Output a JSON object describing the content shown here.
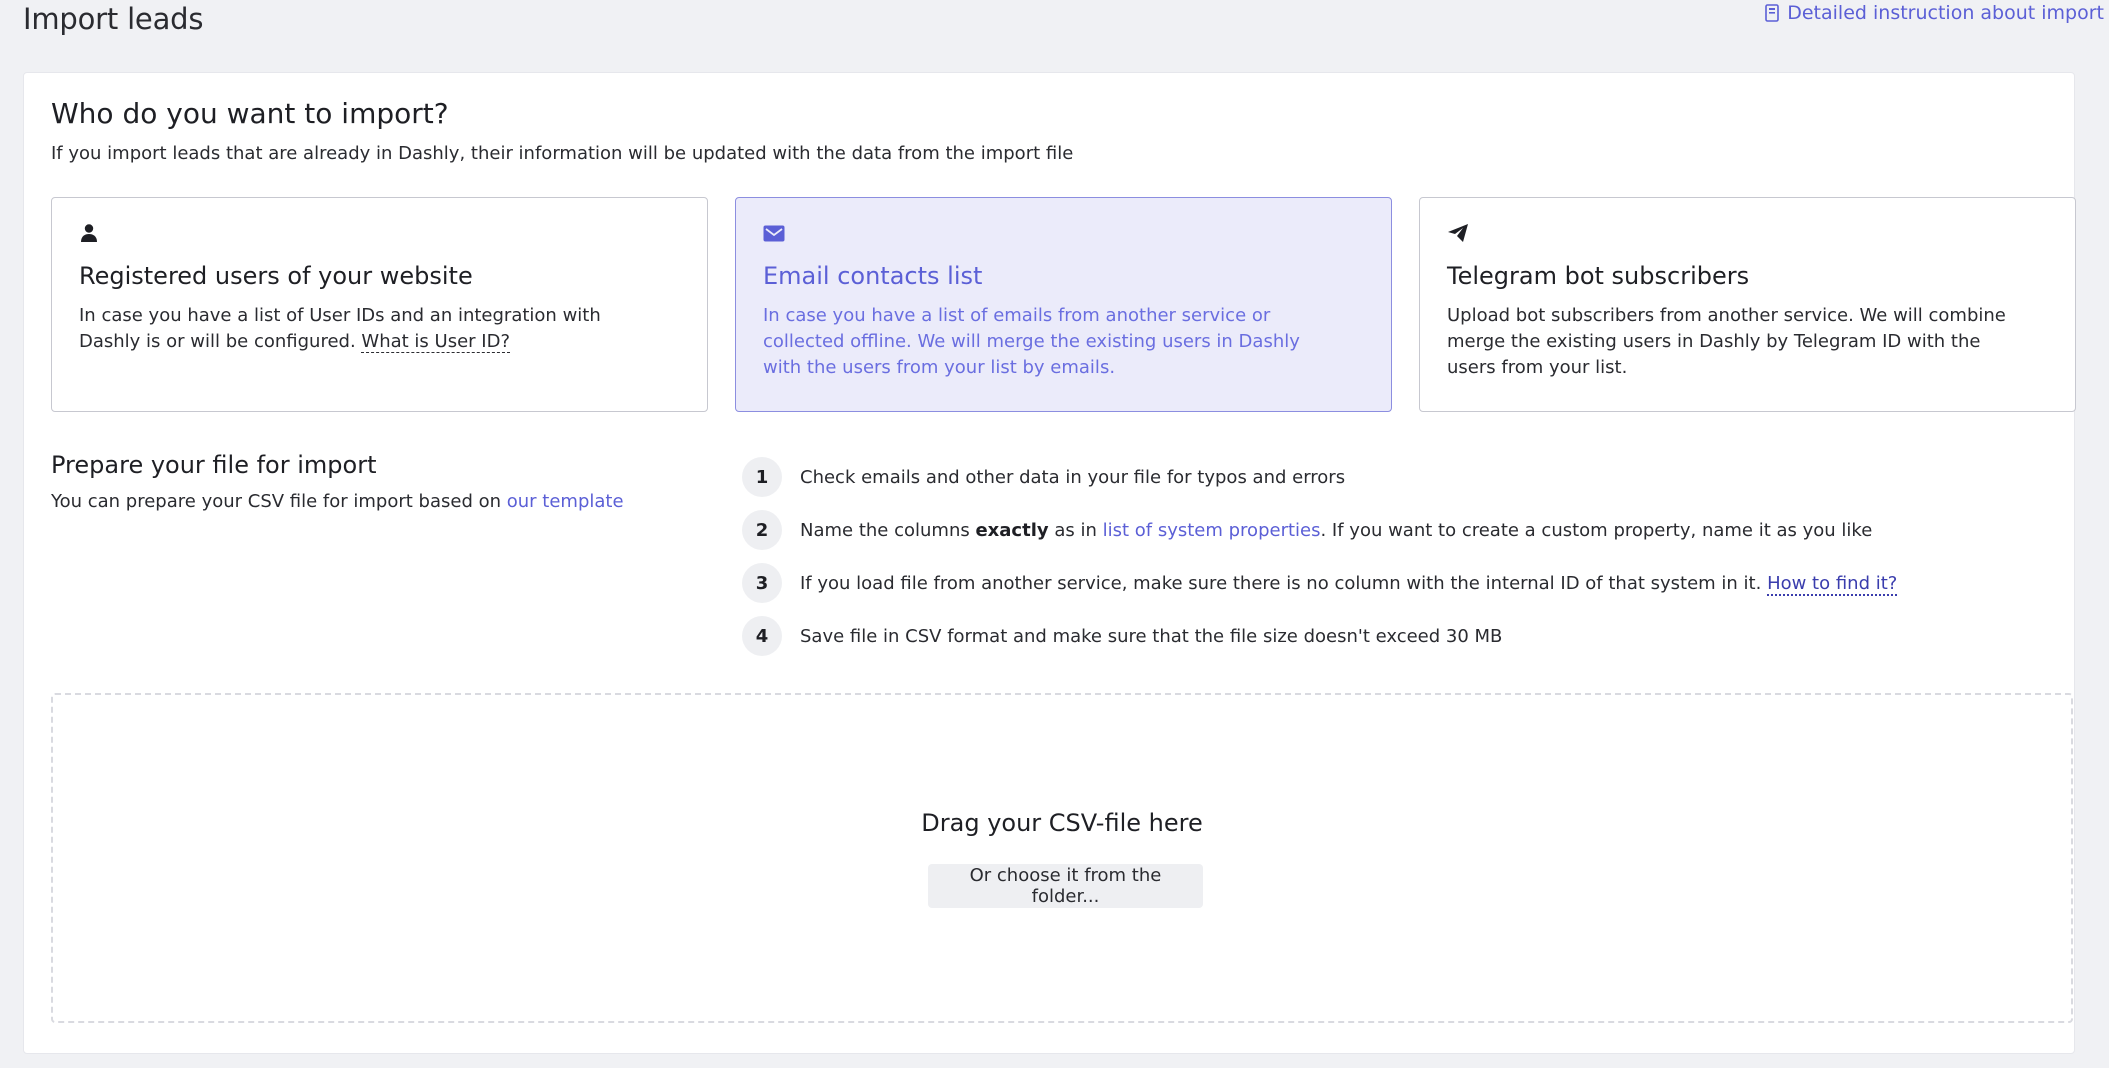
{
  "header": {
    "title": "Import leads",
    "instruction_link": "Detailed instruction about import",
    "instruction_icon": "document-icon"
  },
  "who": {
    "title": "Who do you want to import?",
    "subtitle": "If you import leads that are already in Dashly, their information will be updated with the data from the import file"
  },
  "cards": [
    {
      "icon": "user-icon",
      "title": "Registered users of your website",
      "text": "In case you have a list of User IDs and an integration with Dashly is or will be configured. ",
      "link": "What is User ID?",
      "selected": false
    },
    {
      "icon": "envelope-icon",
      "title": "Email contacts list",
      "text": "In case you have a list of emails from another service or collected offline. We will merge the existing users in Dashly with the users from your list by emails.",
      "selected": true
    },
    {
      "icon": "telegram-icon",
      "title": "Telegram bot subscribers",
      "text": "Upload bot subscribers from another service. We will combine merge the existing users in Dashly by Telegram ID with the users from your list.",
      "selected": false
    }
  ],
  "prepare": {
    "title": "Prepare your file for import",
    "text": "You can prepare your CSV file for import based on ",
    "link": "our template"
  },
  "steps": [
    {
      "num": "1",
      "text": "Check emails and other data in your file for typos and errors"
    },
    {
      "num": "2",
      "pre": "Name the columns ",
      "bold": "exactly",
      "mid": " as in ",
      "link": "list of system properties",
      "post": ". If you want to create a custom property, name it as you like"
    },
    {
      "num": "3",
      "text": "If you load file from another service, make sure there is no column with the internal ID of that system in it. ",
      "link": "How to find it?"
    },
    {
      "num": "4",
      "text": "Save file in CSV format and make sure that the file size doesn't exceed 30 MB"
    }
  ],
  "dropzone": {
    "title": "Drag your CSV-file here",
    "button": "Or choose it from the folder..."
  },
  "colors": {
    "accent": "#5b5fd6",
    "selected_bg": "#ebebfa",
    "page_bg": "#f0f1f4"
  }
}
